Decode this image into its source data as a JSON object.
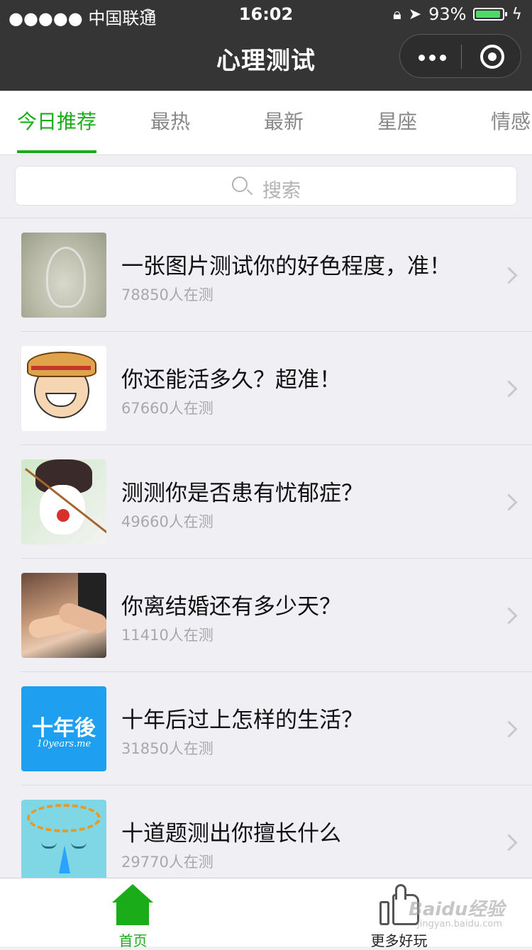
{
  "status_bar": {
    "carrier": "●●●●● 中国联通",
    "time": "16:02",
    "battery": "93%",
    "battery_level": 0.93
  },
  "nav": {
    "title": "心理测试"
  },
  "tabs": [
    {
      "label": "今日推荐",
      "active": true
    },
    {
      "label": "最热"
    },
    {
      "label": "最新"
    },
    {
      "label": "星座"
    },
    {
      "label": "情感"
    }
  ],
  "search": {
    "placeholder": "搜索"
  },
  "tests": [
    {
      "title": "一张图片测试你的好色程度，准！",
      "count": "78850人在测"
    },
    {
      "title": "你还能活多久？超准！",
      "count": "67660人在测"
    },
    {
      "title": "测测你是否患有忧郁症？",
      "count": "49660人在测"
    },
    {
      "title": "你离结婚还有多少天？",
      "count": "11410人在测"
    },
    {
      "title": "十年后过上怎样的生活？",
      "count": "31850人在测",
      "thumb_text": "十年後",
      "thumb_sub": "10years.me"
    },
    {
      "title": "十道题测出你擅长什么",
      "count": "29770人在测"
    }
  ],
  "tabbar": {
    "home_label": "首页",
    "more_label": "更多好玩"
  },
  "watermark": {
    "brand": "Baidu经验",
    "url": "jingyan.baidu.com"
  },
  "colors": {
    "accent": "#1aad19",
    "navbar": "#353535"
  }
}
